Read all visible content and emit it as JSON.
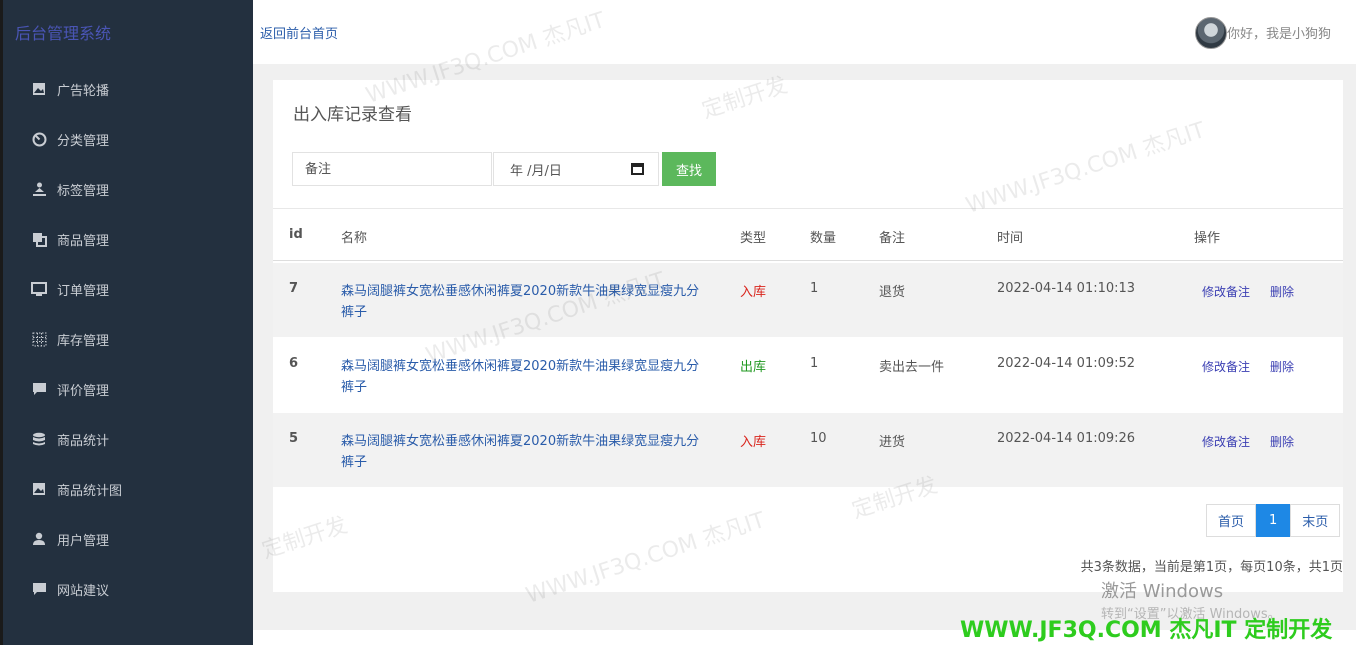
{
  "sidebar": {
    "brand": "后台管理系统",
    "items": [
      {
        "label": "广告轮播",
        "icon": "image-icon"
      },
      {
        "label": "分类管理",
        "icon": "dashboard-icon"
      },
      {
        "label": "标签管理",
        "icon": "user-stand-icon"
      },
      {
        "label": "商品管理",
        "icon": "copy-icon"
      },
      {
        "label": "订单管理",
        "icon": "monitor-icon"
      },
      {
        "label": "库存管理",
        "icon": "grid-icon"
      },
      {
        "label": "评价管理",
        "icon": "comment-icon"
      },
      {
        "label": "商品统计",
        "icon": "database-icon"
      },
      {
        "label": "商品统计图",
        "icon": "image-icon"
      },
      {
        "label": "用户管理",
        "icon": "user-icon"
      },
      {
        "label": "网站建议",
        "icon": "comment-icon"
      }
    ]
  },
  "header": {
    "back_link": "返回前台首页",
    "greeting": "你好，我是小狗狗"
  },
  "panel": {
    "title": "出入库记录查看",
    "search": {
      "note_placeholder": "备注",
      "date_placeholder": "年 /月/日",
      "button": "查找"
    },
    "columns": {
      "id": "id",
      "name": "名称",
      "type": "类型",
      "qty": "数量",
      "note": "备注",
      "time": "时间",
      "ops": "操作"
    },
    "rows": [
      {
        "id": "7",
        "name": "森马阔腿裤女宽松垂感休闲裤夏2020新款牛油果绿宽显瘦九分裤子",
        "type": "入库",
        "qty": "1",
        "note": "退货",
        "time": "2022-04-14 01:10:13",
        "edit": "修改备注",
        "delete": "删除"
      },
      {
        "id": "6",
        "name": "森马阔腿裤女宽松垂感休闲裤夏2020新款牛油果绿宽显瘦九分裤子",
        "type": "出库",
        "qty": "1",
        "note": "卖出去一件",
        "time": "2022-04-14 01:09:52",
        "edit": "修改备注",
        "delete": "删除"
      },
      {
        "id": "5",
        "name": "森马阔腿裤女宽松垂感休闲裤夏2020新款牛油果绿宽显瘦九分裤子",
        "type": "入库",
        "qty": "10",
        "note": "进货",
        "time": "2022-04-14 01:09:26",
        "edit": "修改备注",
        "delete": "删除"
      }
    ],
    "pager": {
      "first": "首页",
      "current": "1",
      "last": "末页",
      "info": "共3条数据，当前是第1页，每页10条，共1页"
    }
  },
  "overlay": {
    "activate_title": "激活 Windows",
    "activate_sub": "转到“设置”以激活 Windows。",
    "brand_watermark": "WWW.JF3Q.COM 杰凡IT  定制开发",
    "bg_watermark_a": "WWW.JF3Q.COM 杰凡IT",
    "bg_watermark_b": "定制开发"
  },
  "colors": {
    "sidebar_bg": "#23303f",
    "search_button": "#5cb85c",
    "type_in": "#d9251d",
    "type_out": "#229922",
    "pager_active": "#1e88e5",
    "brand_watermark": "#2ecc1e"
  }
}
